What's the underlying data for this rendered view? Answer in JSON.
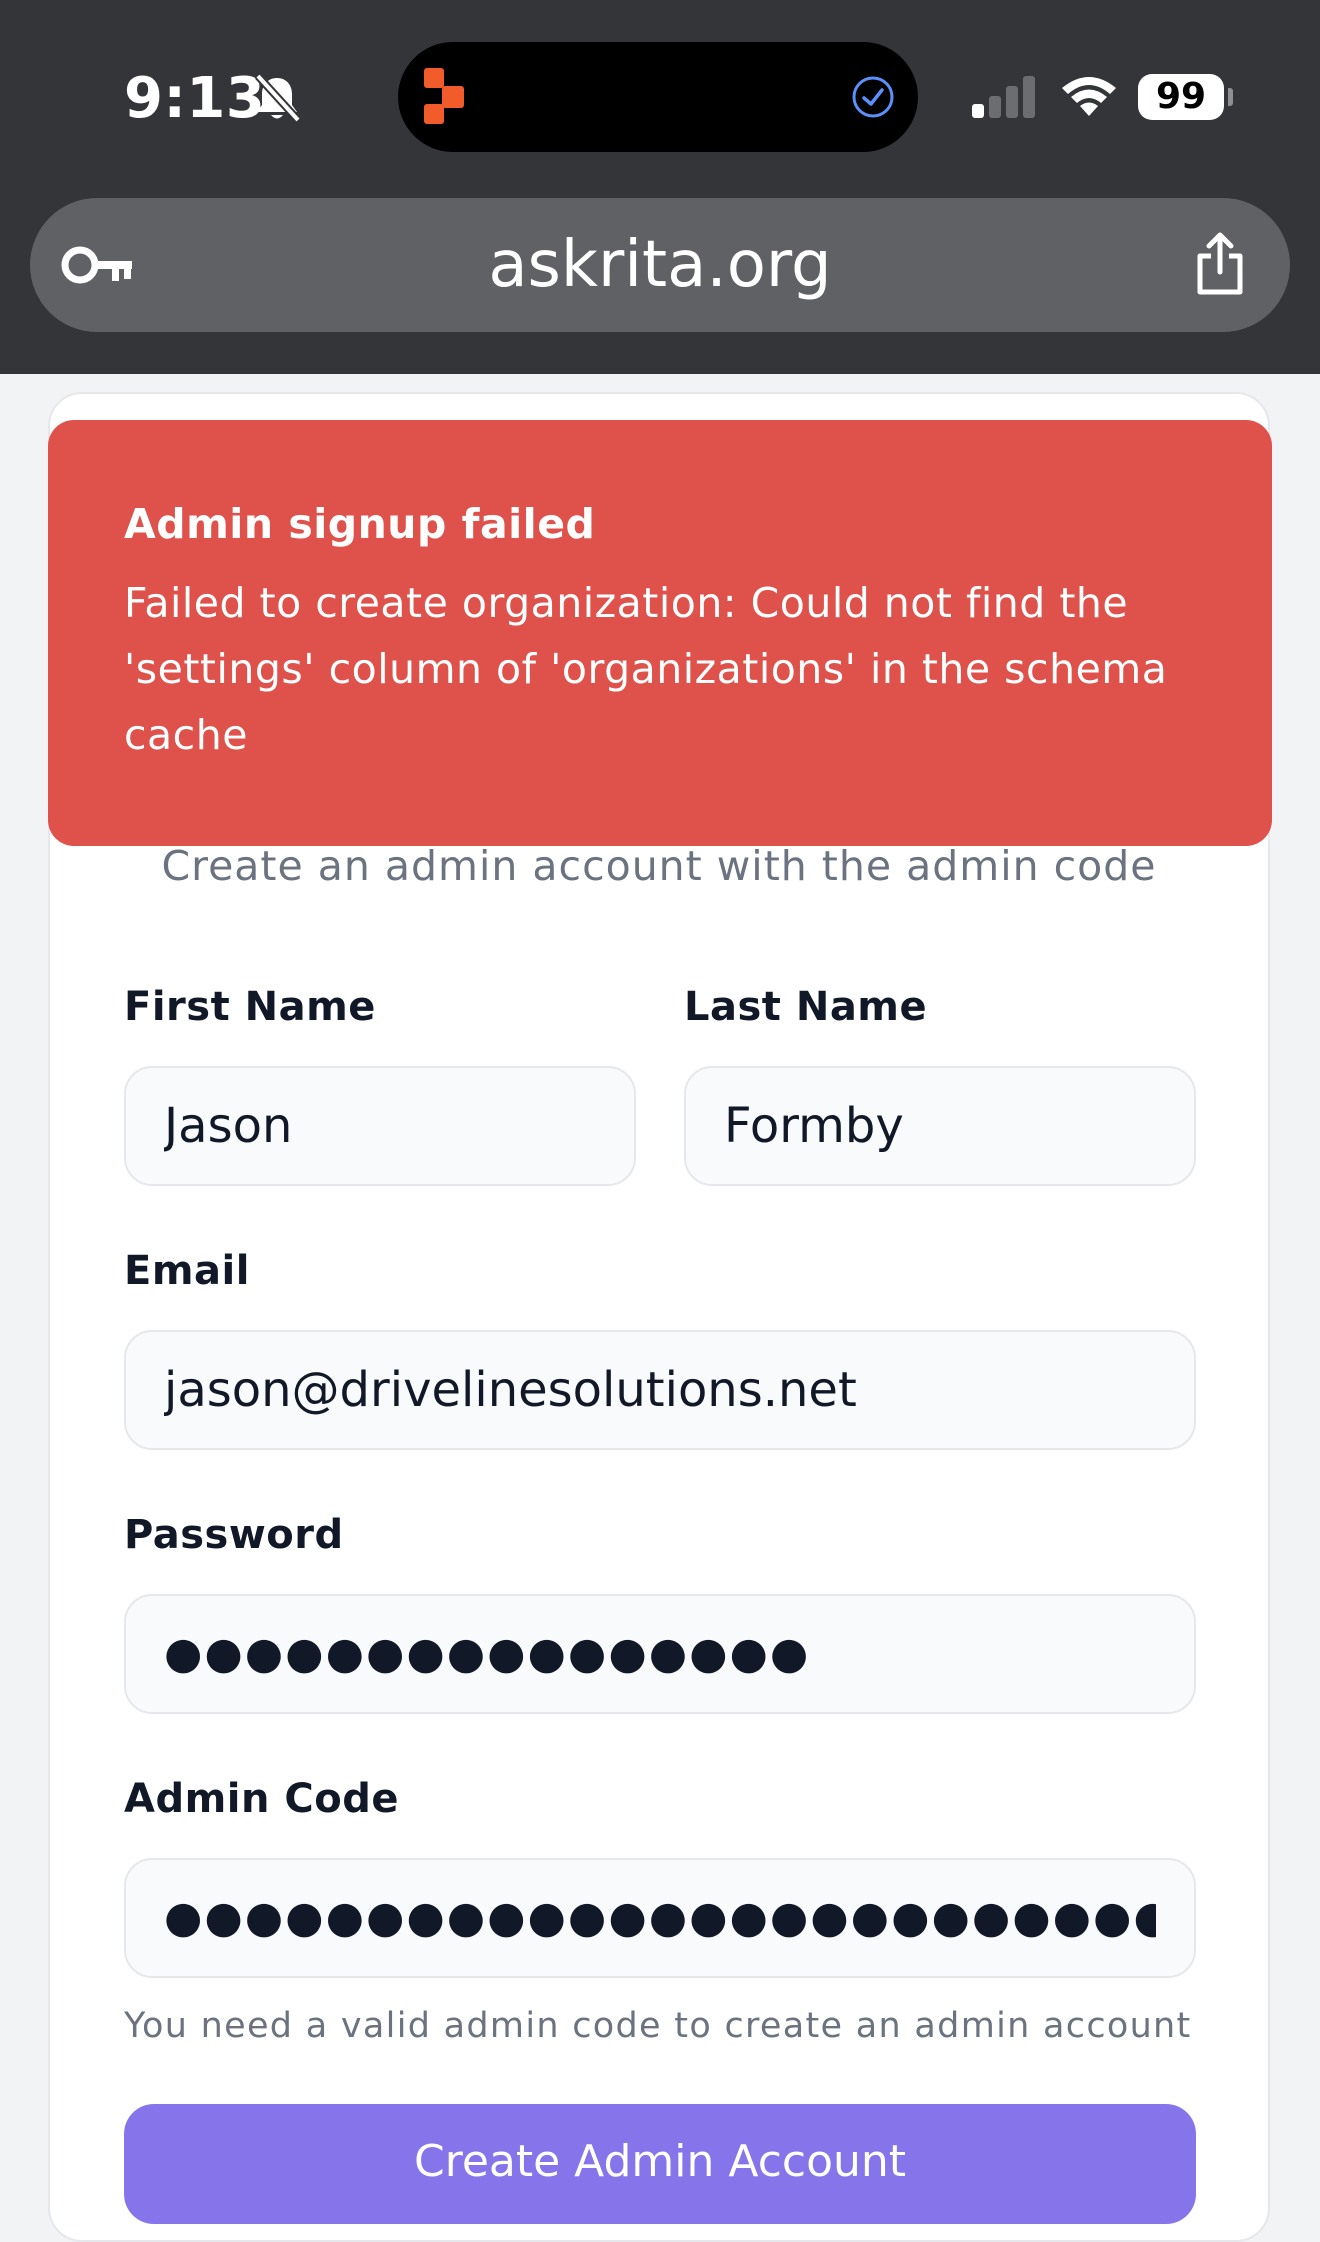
{
  "status_bar": {
    "time": "9:13",
    "battery": "99",
    "icons": [
      "bell-slash-icon",
      "app-icon",
      "check-circle-icon",
      "cellular-signal-icon",
      "wifi-icon",
      "battery-icon"
    ]
  },
  "browser": {
    "url": "askrita.org",
    "icons": [
      "key-icon",
      "share-icon"
    ]
  },
  "toast": {
    "title": "Admin signup failed",
    "message": "Failed to create organization: Could not find the 'settings' column of 'organizations' in the schema cache",
    "color": "#df524b"
  },
  "form": {
    "subtitle": "Create an admin account with the admin code",
    "first_name": {
      "label": "First Name",
      "value": "Jason"
    },
    "last_name": {
      "label": "Last Name",
      "value": "Formby"
    },
    "email": {
      "label": "Email",
      "value": "jason@drivelinesolutions.net"
    },
    "password": {
      "label": "Password",
      "value": "●●●●●●●●●●●●●●●●"
    },
    "admin_code": {
      "label": "Admin Code",
      "value": "●●●●●●●●●●●●●●●●●●●●●●●●●●●●●●●●●"
    },
    "hint": "You need a valid admin code to create an admin account",
    "submit_label": "Create Admin Account",
    "accent_color": "#8674ea"
  }
}
